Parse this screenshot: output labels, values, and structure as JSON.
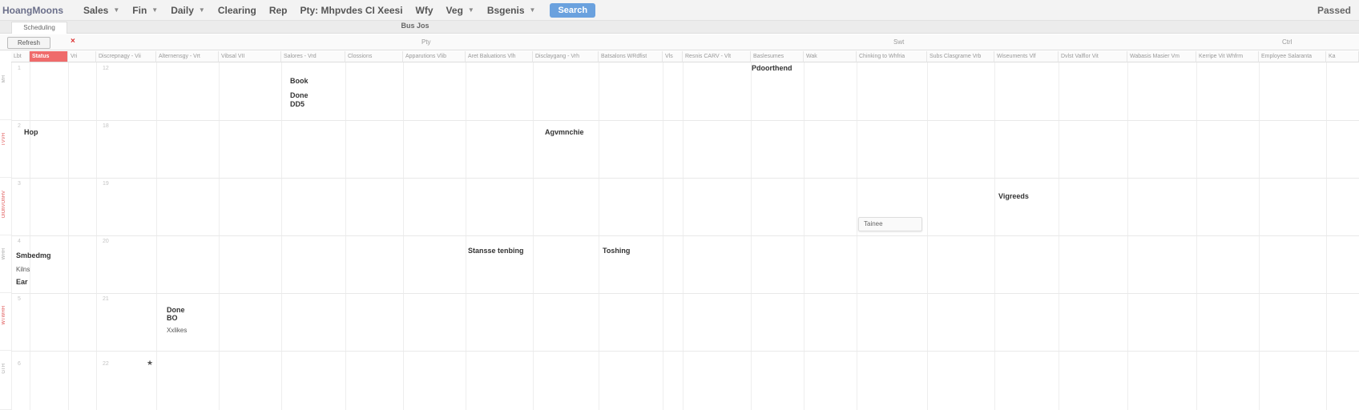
{
  "nav": {
    "brand": "HoangMoons",
    "items": [
      {
        "label": "Sales",
        "caret": true
      },
      {
        "label": "Fin",
        "caret": true
      },
      {
        "label": "Daily",
        "caret": true
      },
      {
        "label": "Clearing",
        "caret": false
      },
      {
        "label": "Rep",
        "caret": false
      },
      {
        "label": "Pty: Mhpvdes CI Xeesi",
        "caret": false
      },
      {
        "label": "Wfy",
        "caret": false
      },
      {
        "label": "Veg",
        "caret": true
      },
      {
        "label": "Bsgenis",
        "caret": true
      }
    ],
    "action_button": "Search",
    "user": "Passed"
  },
  "tabs": {
    "active_tab": "Scheduling",
    "title": "Bus Jos"
  },
  "toolbar": {
    "button": "Refresh",
    "labels": [
      "Pty",
      "Swt",
      "Ctrl"
    ]
  },
  "columns": [
    "Lbt",
    "Status",
    "Vri",
    "Discrepnagy - Vii",
    "Alternensgy - Vrt",
    "Vibsal VII",
    "Salores - Vrd",
    "Clossions",
    "Apparutions Vlib",
    "Aret Baluations Vlh",
    "Disclaygang - Vrh",
    "Batsalons WRdfist",
    "Vls",
    "Resnis CARV - Vlt",
    "Baslesumes",
    "Wak",
    "Chinking to Whfria",
    "Subs Clasgrame Vrb",
    "Wiseuments Vlf",
    "Dvlst Valflor Vit",
    "Wabasis Masier Vm",
    "Kerripe Vit Whfrm",
    "Employee Salaranta",
    "Ka"
  ],
  "row_labels": [
    "MH",
    "TVVH",
    "OlOhVOhHV",
    "WHH",
    "WTWHH",
    "GTH"
  ],
  "cell_numbers": [
    "1",
    "12",
    "2",
    "18",
    "3",
    "19",
    "4",
    "20",
    "5",
    "21",
    "6",
    "22"
  ],
  "events": [
    {
      "text": "Book",
      "small": false
    },
    {
      "text": "Done",
      "small": false
    },
    {
      "text": "DD5",
      "small": false
    },
    {
      "text": "Pdoorthend",
      "small": false
    },
    {
      "text": "Hop",
      "small": false
    },
    {
      "text": "Agvmnchie",
      "small": false
    },
    {
      "text": "Vigreeds",
      "small": false
    },
    {
      "text": "Smbedmg",
      "small": false
    },
    {
      "text": "Kilns",
      "small": true
    },
    {
      "text": "Ear",
      "small": false
    },
    {
      "text": "Stansse tenbing",
      "small": false
    },
    {
      "text": "Toshing",
      "small": false
    },
    {
      "text": "Done",
      "small": false
    },
    {
      "text": "BO",
      "small": false
    },
    {
      "text": "Xxlikes",
      "small": true
    }
  ],
  "popup": {
    "text": "Tainee"
  },
  "marker": {
    "glyph": "★"
  }
}
